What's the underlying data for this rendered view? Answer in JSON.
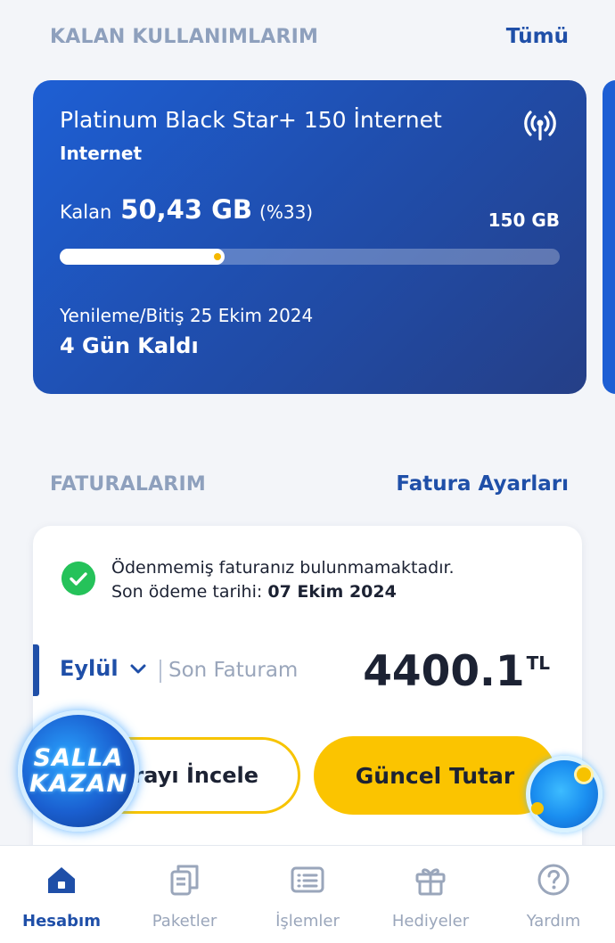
{
  "usage_section": {
    "title": "KALAN KULLANIMLARIM",
    "link": "Tümü"
  },
  "usage_card": {
    "plan_name": "Platinum Black Star+ 150 İnternet",
    "type": "Internet",
    "remaining_label": "Kalan",
    "remaining_value": "50,43 GB",
    "remaining_percent": "(%33)",
    "remaining_fraction": 0.33,
    "total": "150 GB",
    "renewal_date": "Yenileme/Bitiş 25 Ekim 2024",
    "days_left": "4 Gün Kaldı"
  },
  "bill_section": {
    "title": "FATURALARIM",
    "link": "Fatura Ayarları"
  },
  "bill_card": {
    "status_line1": "Ödenmemiş faturanız bulunmamaktadır.",
    "due_label": "Son ödeme tarihi:",
    "due_date": "07 Ekim 2024",
    "month": "Eylül",
    "last_bill_label": "Son Faturam",
    "amount": "4400.1",
    "currency": "TL",
    "review_button": "urayı İncele",
    "current_button": "Güncel Tutar"
  },
  "promo": {
    "line1": "SALLA",
    "line2": "KAZAN"
  },
  "tabbar": [
    {
      "label": "Hesabım",
      "icon": "home-icon",
      "active": true
    },
    {
      "label": "Paketler",
      "icon": "packages-icon",
      "active": false
    },
    {
      "label": "İşlemler",
      "icon": "list-icon",
      "active": false
    },
    {
      "label": "Hediyeler",
      "icon": "gift-icon",
      "active": false
    },
    {
      "label": "Yardım",
      "icon": "help-icon",
      "active": false
    }
  ],
  "colors": {
    "primary": "#1f4fa8",
    "accent_yellow": "#fbc400",
    "success": "#25c25a"
  }
}
